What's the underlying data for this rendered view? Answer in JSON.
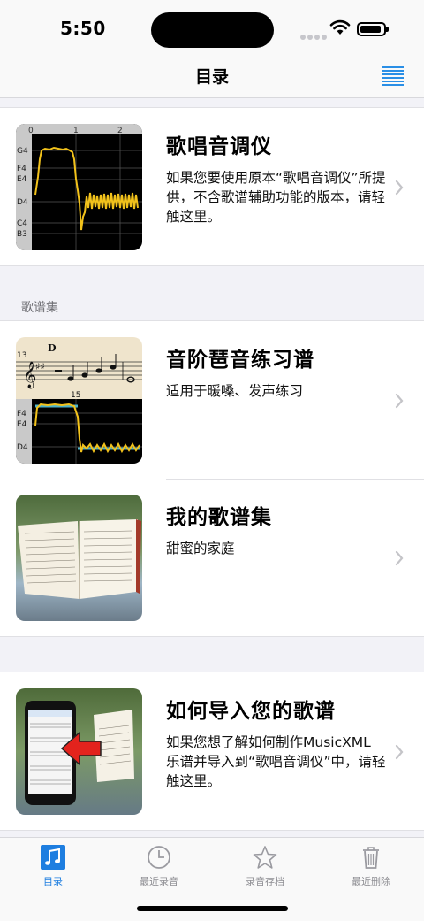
{
  "status": {
    "time": "5:50"
  },
  "nav": {
    "title": "目录"
  },
  "top_item": {
    "title": "歌唱音调仪",
    "description": "如果您要使用原本“歌唱音调仪”所提供，不含歌谱辅助功能的版本，请轻触这里。",
    "axis_ticks": [
      "0",
      "1",
      "2"
    ],
    "note_labels": [
      "G4",
      "F4",
      "E4",
      "D4",
      "C4",
      "B3"
    ]
  },
  "songbook_section": {
    "header": "歌谱集",
    "items": [
      {
        "title": "音阶琶音练习谱",
        "description": "适用于暖嗓、发声练习",
        "score_key": "D",
        "measure_start": "13",
        "measure_mid": "15",
        "note_labels": [
          "F4",
          "E4",
          "D4"
        ]
      },
      {
        "title": "我的歌谱集",
        "description": "甜蜜的家庭"
      }
    ]
  },
  "import_item": {
    "title": "如何导入您的歌谱",
    "description": "如果您想了解如何制作MusicXML 乐谱并导入到“歌唱音调仪”中，请轻触这里。"
  },
  "tabs": [
    {
      "label": "目录",
      "icon": "music-note-icon",
      "active": true
    },
    {
      "label": "最近录音",
      "icon": "clock-icon",
      "active": false
    },
    {
      "label": "录音存档",
      "icon": "star-icon",
      "active": false
    },
    {
      "label": "最近删除",
      "icon": "trash-icon",
      "active": false
    }
  ],
  "colors": {
    "accent": "#1e7ee0",
    "pitch_trace": "#f2c21b",
    "reference_line": "#4fb3c8"
  }
}
